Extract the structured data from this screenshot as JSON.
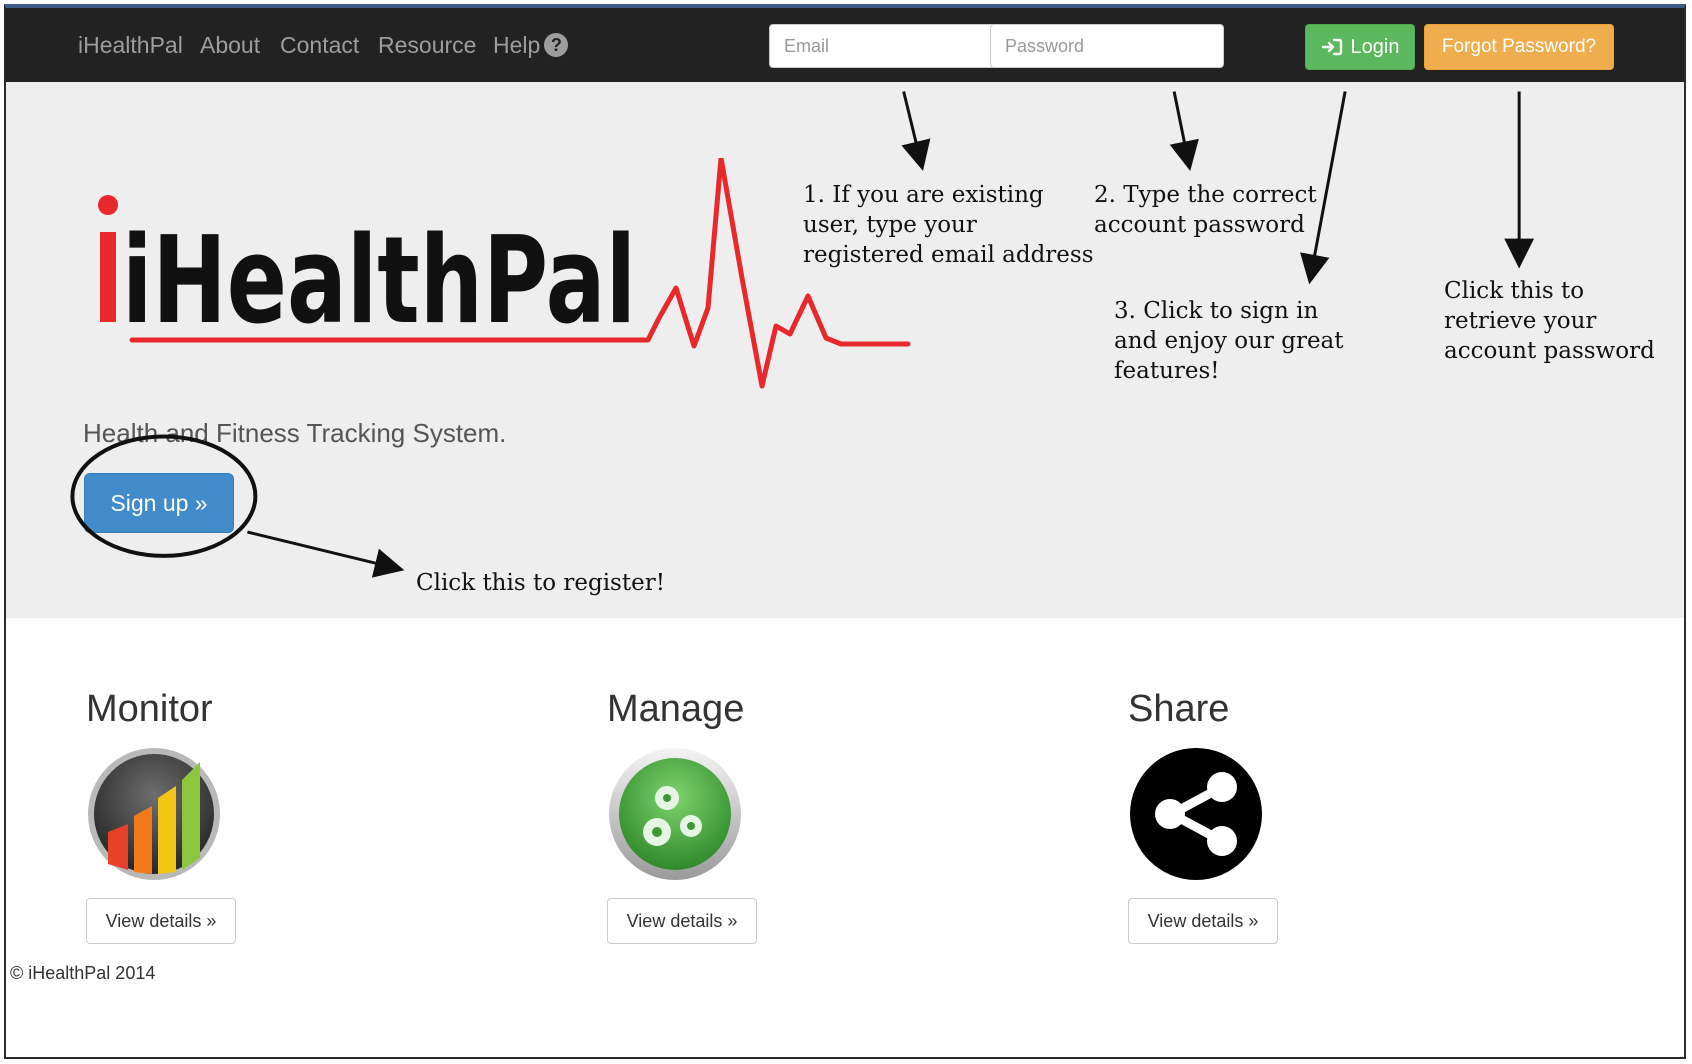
{
  "nav": {
    "brand": "iHealthPal",
    "links": [
      "About",
      "Contact",
      "Resource",
      "Help"
    ],
    "email_placeholder": "Email",
    "password_placeholder": "Password",
    "login_label": "Login",
    "forgot_label": "Forgot Password?"
  },
  "hero": {
    "logo_text": "iHealthPal",
    "tagline": "Health and Fitness Tracking System.",
    "signup_label": "Sign up »"
  },
  "annotations": {
    "email": "1. If you are existing\nuser, type your\nregistered email address",
    "password": "2. Type the correct\naccount password",
    "login": "3. Click to sign in\nand enjoy our great\nfeatures!",
    "forgot": "Click this to\nretrieve your\naccount password",
    "register": "Click this to register!"
  },
  "features": [
    {
      "title": "Monitor",
      "icon": "bar-chart-icon",
      "button": "View details »"
    },
    {
      "title": "Manage",
      "icon": "gears-icon",
      "button": "View details »"
    },
    {
      "title": "Share",
      "icon": "share-icon",
      "button": "View details »"
    }
  ],
  "footer": "© iHealthPal 2014",
  "colors": {
    "navbar": "#222222",
    "login": "#5cb85c",
    "forgot": "#f0ad4e",
    "signup": "#428bca",
    "jumbotron": "#eeeeee",
    "logo_red": "#e8282b"
  }
}
